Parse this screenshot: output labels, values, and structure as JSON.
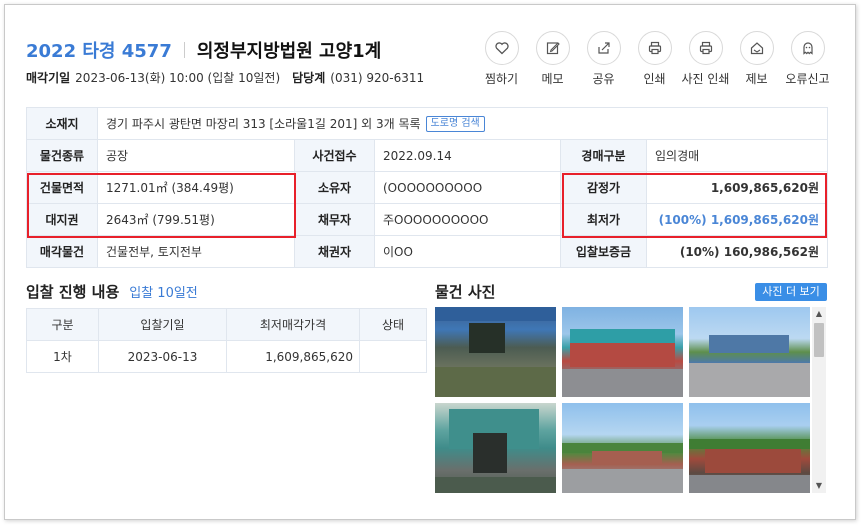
{
  "header": {
    "case_no": "2022 타경 4577",
    "court": "의정부지방법원 고양1계",
    "sale_date_label": "매각기일",
    "sale_date_value": "2023-06-13(화) 10:00 (입찰 10일전)",
    "dept_label": "담당계",
    "dept_value": "(031) 920-6311"
  },
  "actions": [
    {
      "label": "찜하기",
      "icon": "heart-icon"
    },
    {
      "label": "메모",
      "icon": "pencil-icon"
    },
    {
      "label": "공유",
      "icon": "share-icon"
    },
    {
      "label": "인쇄",
      "icon": "printer-icon"
    },
    {
      "label": "사진 인쇄",
      "icon": "printer-icon"
    },
    {
      "label": "제보",
      "icon": "home-alert-icon"
    },
    {
      "label": "오류신고",
      "icon": "ghost-icon"
    }
  ],
  "info": {
    "location_label": "소재지",
    "location_value": "경기 파주시 광탄면 마장리 313 [소라울1길 201] 외 3개 목록",
    "road_search": "도로명 검색",
    "type_label": "물건종류",
    "type_value": "공장",
    "received_label": "사건접수",
    "received_value": "2022.09.14",
    "auction_type_label": "경매구분",
    "auction_type_value": "임의경매",
    "building_area_label": "건물면적",
    "building_area_value": "1271.01㎡ (384.49평)",
    "owner_label": "소유자",
    "owner_value": "(OOOOOOOOOO",
    "appraisal_label": "감정가",
    "appraisal_value": "1,609,865,620원",
    "land_right_label": "대지권",
    "land_right_value": "2643㎡ (799.51평)",
    "debtor_label": "채무자",
    "debtor_value": "주OOOOOOOOOO",
    "min_price_label": "최저가",
    "min_price_value": "(100%) 1,609,865,620원",
    "sale_object_label": "매각물건",
    "sale_object_value": "건물전부, 토지전부",
    "creditor_label": "채권자",
    "creditor_value": "이OO",
    "deposit_label": "입찰보증금",
    "deposit_value": "(10%) 160,986,562원"
  },
  "bid": {
    "title": "입찰 진행 내용",
    "subtitle": "입찰 10일전",
    "columns": [
      "구분",
      "입찰기일",
      "최저매각가격",
      "상태"
    ],
    "rows": [
      {
        "round": "1차",
        "date": "2023-06-13",
        "price": "1,609,865,620",
        "status": ""
      }
    ]
  },
  "photos": {
    "title": "물건 사진",
    "more_button": "사진 더 보기"
  },
  "colors": {
    "accent_blue": "#3a7bd5",
    "highlight_red": "#e8202a",
    "header_cell_bg": "#f2f6fb"
  }
}
